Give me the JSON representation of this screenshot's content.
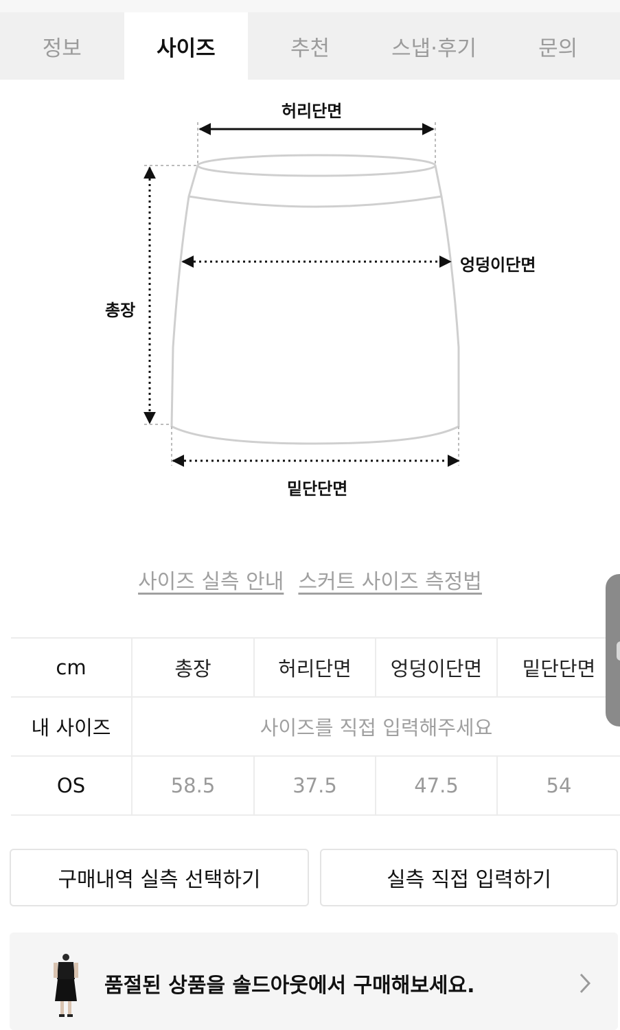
{
  "tabs": [
    {
      "label": "정보"
    },
    {
      "label": "사이즈"
    },
    {
      "label": "추천"
    },
    {
      "label": "스냅·후기"
    },
    {
      "label": "문의"
    }
  ],
  "diagram": {
    "waist": "허리단면",
    "hip": "엉덩이단면",
    "length": "총장",
    "hem": "밑단단면"
  },
  "guides": {
    "size_guide": "사이즈 실측 안내",
    "skirt_method": "스커트 사이즈 측정법"
  },
  "table": {
    "header": [
      "cm",
      "총장",
      "허리단면",
      "엉덩이단면",
      "밑단단면"
    ],
    "my_size_label": "내 사이즈",
    "my_size_hint": "사이즈를 직접 입력해주세요",
    "rows": [
      {
        "size": "OS",
        "values": [
          "58.5",
          "37.5",
          "47.5",
          "54"
        ]
      }
    ]
  },
  "buttons": {
    "purchase_select": "구매내역 실측 선택하기",
    "direct_input": "실측 직접 입력하기"
  },
  "banner": {
    "text": "품절된 상품을 솔드아웃에서 구매해보세요.",
    "icon": "chevron-right-icon"
  }
}
